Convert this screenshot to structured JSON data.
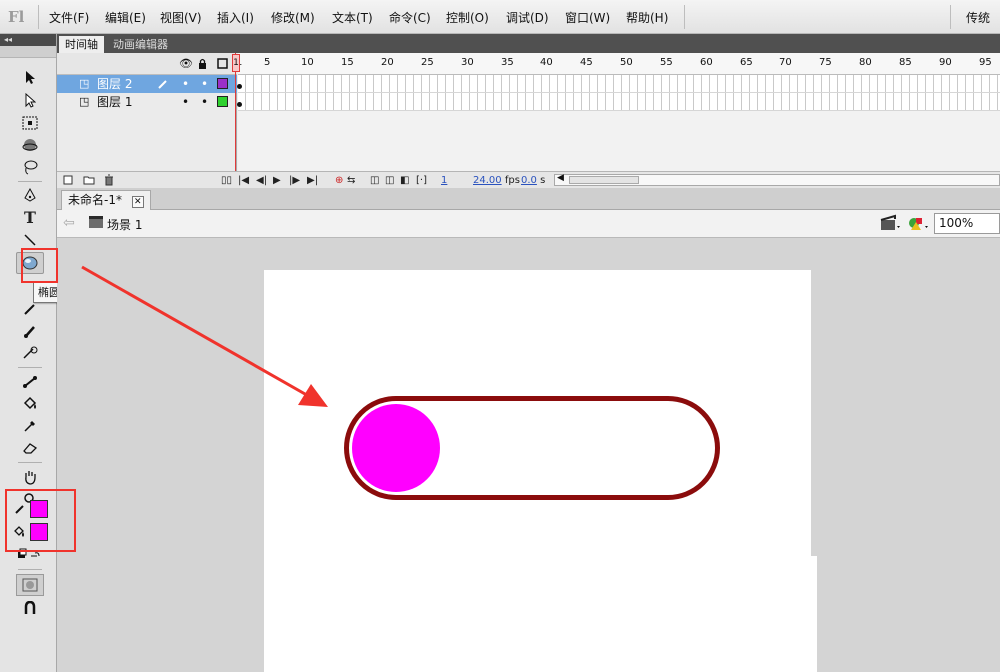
{
  "app": {
    "logo": "Fl",
    "workspace": "传统"
  },
  "menu": [
    "文件(F)",
    "编辑(E)",
    "视图(V)",
    "插入(I)",
    "修改(M)",
    "文本(T)",
    "命令(C)",
    "控制(O)",
    "调试(D)",
    "窗口(W)",
    "帮助(H)"
  ],
  "tools": {
    "collapse_glyph": "◂◂",
    "tooltip": "椭圆工具(O)",
    "stroke_color": "#ff00ff",
    "fill_color": "#ff00ff",
    "items": [
      "selection-arrow-icon",
      "subselection-arrow-icon",
      "free-transform-icon",
      "3d-rotation-icon",
      "lasso-icon",
      "pen-icon",
      "text-icon",
      "line-icon",
      "oval-icon",
      "pencil-icon",
      "brush-icon",
      "deco-icon",
      "bone-icon",
      "paint-bucket-icon",
      "eyedropper-icon",
      "eraser-icon",
      "hand-icon",
      "zoom-icon"
    ],
    "text_glyph": "T"
  },
  "timeline": {
    "tabs": [
      "时间轴",
      "动画编辑器"
    ],
    "layers": [
      {
        "name": "图层 2",
        "color": "#9b30c8",
        "selected": true
      },
      {
        "name": "图层 1",
        "color": "#2fd12f",
        "selected": false
      }
    ],
    "ruler": [
      "1",
      "5",
      "10",
      "15",
      "20",
      "25",
      "30",
      "35",
      "40",
      "45",
      "50",
      "55",
      "60",
      "65",
      "70",
      "75",
      "80",
      "85",
      "90",
      "95"
    ],
    "current_frame": "1",
    "fps": "24.00",
    "fps_unit": "fps",
    "time": "0.0",
    "time_unit": "s"
  },
  "document": {
    "tab_title": "未命名-1*",
    "close_glyph": "✕",
    "scene": "场景 1",
    "zoom": "100%"
  },
  "stage": {
    "background": "#ffffff",
    "toggle_border_color": "#8b0c0c",
    "knob_color": "#ff00ff"
  },
  "annotation": {
    "color": "#f0332c"
  }
}
